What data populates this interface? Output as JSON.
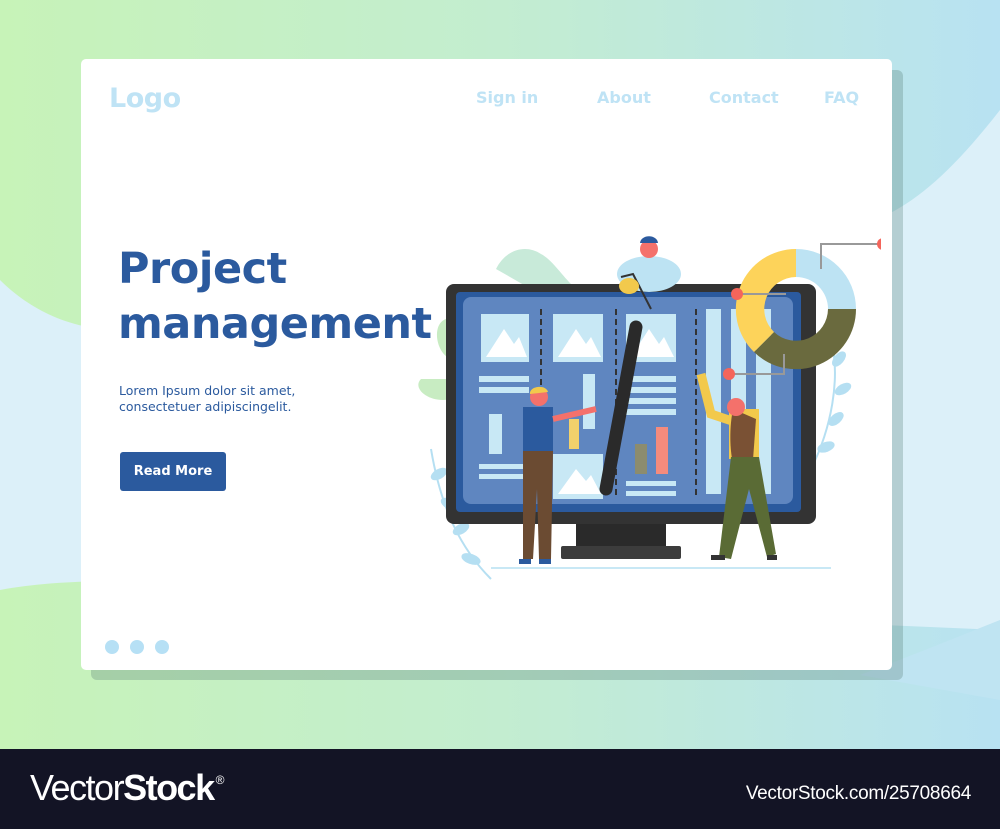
{
  "header": {
    "logo": "Logo",
    "nav": [
      "Sign in",
      "About",
      "Contact",
      "FAQ"
    ]
  },
  "hero": {
    "title_line1": "Project",
    "title_line2": "management",
    "subtitle_line1": "Lorem Ipsum dolor sit amet,",
    "subtitle_line2": "consectetuer adipiscingelit.",
    "button_label": "Read More"
  },
  "pagination": {
    "dots": 3
  },
  "illustration": {
    "description": "People managing project board on monitor with donut chart",
    "donut_segments": [
      {
        "color": "#bde3f3",
        "share": 0.25
      },
      {
        "color": "#6a6a3e",
        "share": 0.4
      },
      {
        "color": "#fdd35a",
        "share": 0.35
      }
    ]
  },
  "colors": {
    "primary": "#2b5a9e",
    "light_blue": "#bfe3f5",
    "accent_red": "#f4655b",
    "footer_bg": "#131425"
  },
  "watermark": {
    "brand_light": "Vector",
    "brand_bold": "Stock",
    "registered": "®",
    "stock_id": "VectorStock.com/25708664"
  }
}
